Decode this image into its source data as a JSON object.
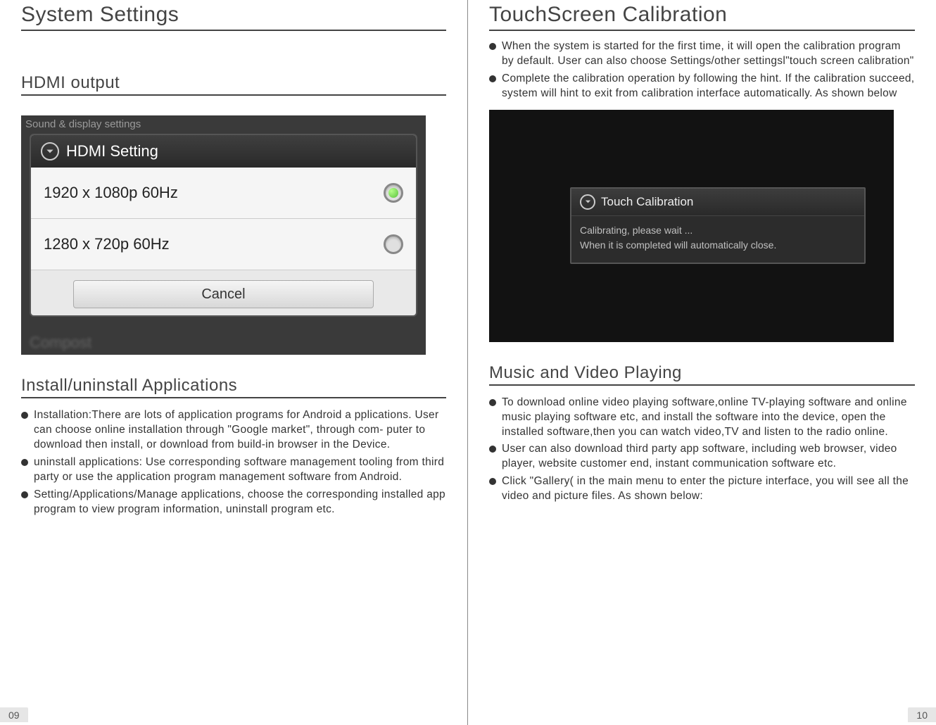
{
  "left": {
    "title": "System Settings",
    "hdmi_section": "HDMI output",
    "screenshot": {
      "bg_text": "Sound & display settings",
      "header": "HDMI Setting",
      "option1": "1920 x 1080p 60Hz",
      "option2": "1280 x 720p 60Hz",
      "cancel": "Cancel",
      "blur_text": "Compost"
    },
    "install_section": "Install/uninstall Applications",
    "install_bullets": [
      "Installation:There are lots of application programs for Android a pplications. User can choose online installation through \"Google market\", through com- puter to download then install, or download from build-in browser in the Device.",
      "uninstall applications: Use corresponding software management tooling from third party or use the application program management software from Android.",
      "Setting/Applications/Manage applications, choose the corresponding installed app program to view program information, uninstall program etc."
    ],
    "page_num": "09"
  },
  "right": {
    "title": "TouchScreen Calibration",
    "touch_bullets": [
      "When the system is started for the first time, it will open the calibration program by default. User can also choose Settings/other settingsl\"touch screen calibration\"",
      "Complete the calibration operation by following the hint. If the calibration succeed, system will hint to exit from calibration interface automatically. As shown below"
    ],
    "touch_screenshot": {
      "header": "Touch Calibration",
      "line1": "Calibrating, please wait ...",
      "line2": "When it is completed will automatically close."
    },
    "music_section": "Music and Video Playing",
    "music_bullets": [
      "To download online video playing software,online TV-playing software and online music playing software etc, and install the software into the device, open the installed software,then you can watch video,TV and listen to the radio online.",
      "User can also download third party app software, including web browser, video player, website customer end, instant communication software etc.",
      "Click \"Gallery( in the main menu to enter the picture interface, you will see all the video and picture files. As shown below:"
    ],
    "page_num": "10"
  }
}
